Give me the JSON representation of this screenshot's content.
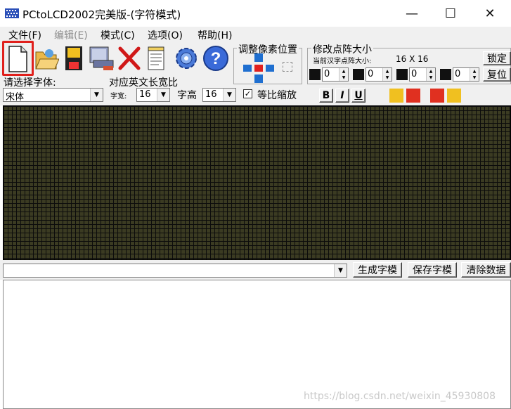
{
  "window": {
    "title": "PCtoLCD2002完美版-(字符模式)",
    "minimize_glyph": "—",
    "maximize_glyph": "☐",
    "close_glyph": "✕"
  },
  "menu": [
    {
      "label": "文件(F)",
      "enabled": true
    },
    {
      "label": "编辑(E)",
      "enabled": false
    },
    {
      "label": "模式(C)",
      "enabled": true
    },
    {
      "label": "选项(O)",
      "enabled": true
    },
    {
      "label": "帮助(H)",
      "enabled": true
    }
  ],
  "toolbar": {
    "icons": [
      "new-file-icon",
      "open-folder-icon",
      "save-disk-icon",
      "import-image-icon",
      "delete-x-icon",
      "notepad-icon",
      "settings-gear-icon",
      "help-question-icon"
    ],
    "pixel_group_label": "调整像素位置",
    "dot_group_label": "修改点阵大小",
    "current_size_label": "当前汉字点阵大小:",
    "current_size_value": "16 X 16",
    "lock_label": "锁定",
    "reset_label": "复位",
    "spinners": [
      "0",
      "0",
      "0",
      "0"
    ]
  },
  "font_row": {
    "choose_font_label": "请选择字体:",
    "font_value": "宋体",
    "en_width_label": "对应英文长宽比",
    "width_label": "字宽:",
    "width_value": "16",
    "height_label": "字高",
    "height_value": "16",
    "proportional_checked": "✓",
    "proportional_label": "等比缩放",
    "bold_label": "B",
    "italic_label": "I",
    "underline_label": "U"
  },
  "bottom": {
    "input_value": "",
    "generate_label": "生成字模",
    "save_label": "保存字模",
    "clear_label": "清除数据"
  },
  "watermark": "https://blog.csdn.net/weixin_45930808",
  "colors": {
    "grid_bg": "#3b3b22",
    "highlight": "#e0201c",
    "toolbar_bg": "#f0f0f0"
  }
}
